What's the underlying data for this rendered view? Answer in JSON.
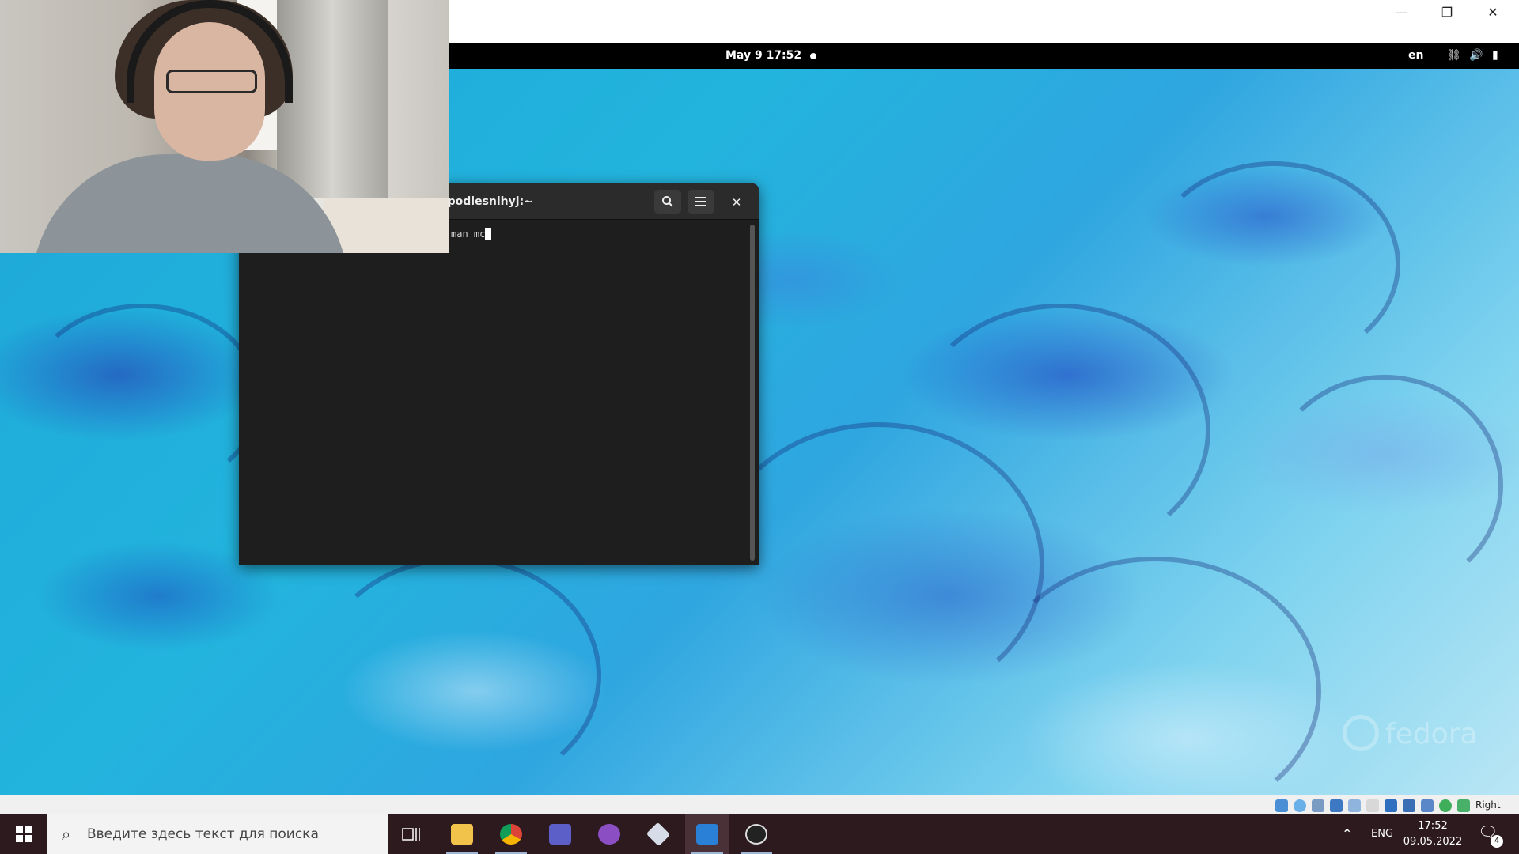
{
  "host_window": {
    "minimize_glyph": "—",
    "restore_glyph": "❐",
    "close_glyph": "✕"
  },
  "gnome_bar": {
    "clock": "May 9  17:52",
    "keyboard_layout": "en",
    "icons": [
      "network-icon",
      "volume-icon",
      "battery-icon"
    ]
  },
  "terminal": {
    "title": "esnihyj@ispodlesnihyj:~",
    "command_line": "man mc",
    "search_icon": "search-icon",
    "menu_icon": "hamburger-menu-icon",
    "close_glyph": "✕"
  },
  "desktop": {
    "watermark": "fedora"
  },
  "vbox_status": {
    "host_key": "Right Ctrl"
  },
  "taskbar": {
    "search_placeholder": "Введите здесь текст для поиска",
    "apps": [
      "task-view",
      "file-explorer",
      "chrome",
      "teams",
      "github-desktop",
      "virtualbox",
      "virtualbox-fedora",
      "obs-studio"
    ],
    "tray_language": "ENG",
    "time": "17:52",
    "date": "09.05.2022",
    "notification_count": "4"
  },
  "colors": {
    "taskbar_bg": "#2d1a1f",
    "terminal_bg": "#1e1e1e",
    "gnome_bar_bg": "#000000"
  }
}
